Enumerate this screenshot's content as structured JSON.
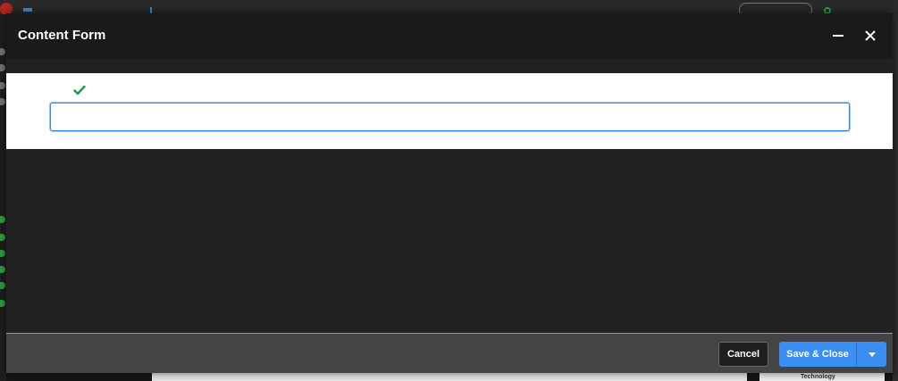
{
  "modal": {
    "title": "Content Form",
    "content_input": {
      "value": "",
      "placeholder": ""
    }
  },
  "footer": {
    "cancel_label": "Cancel",
    "save_label": "Save & Close"
  },
  "background": {
    "bottom_right_label": "Technology"
  },
  "colors": {
    "accent": "#3b8ff3",
    "check": "#1e9a4a",
    "modal_bg": "#222222",
    "header_bg": "#1a1a1a",
    "footer_bg": "#444444"
  },
  "icons": {
    "minimize": "minimize-icon",
    "close": "close-icon",
    "check": "check-icon",
    "dropdown": "caret-down-icon"
  }
}
